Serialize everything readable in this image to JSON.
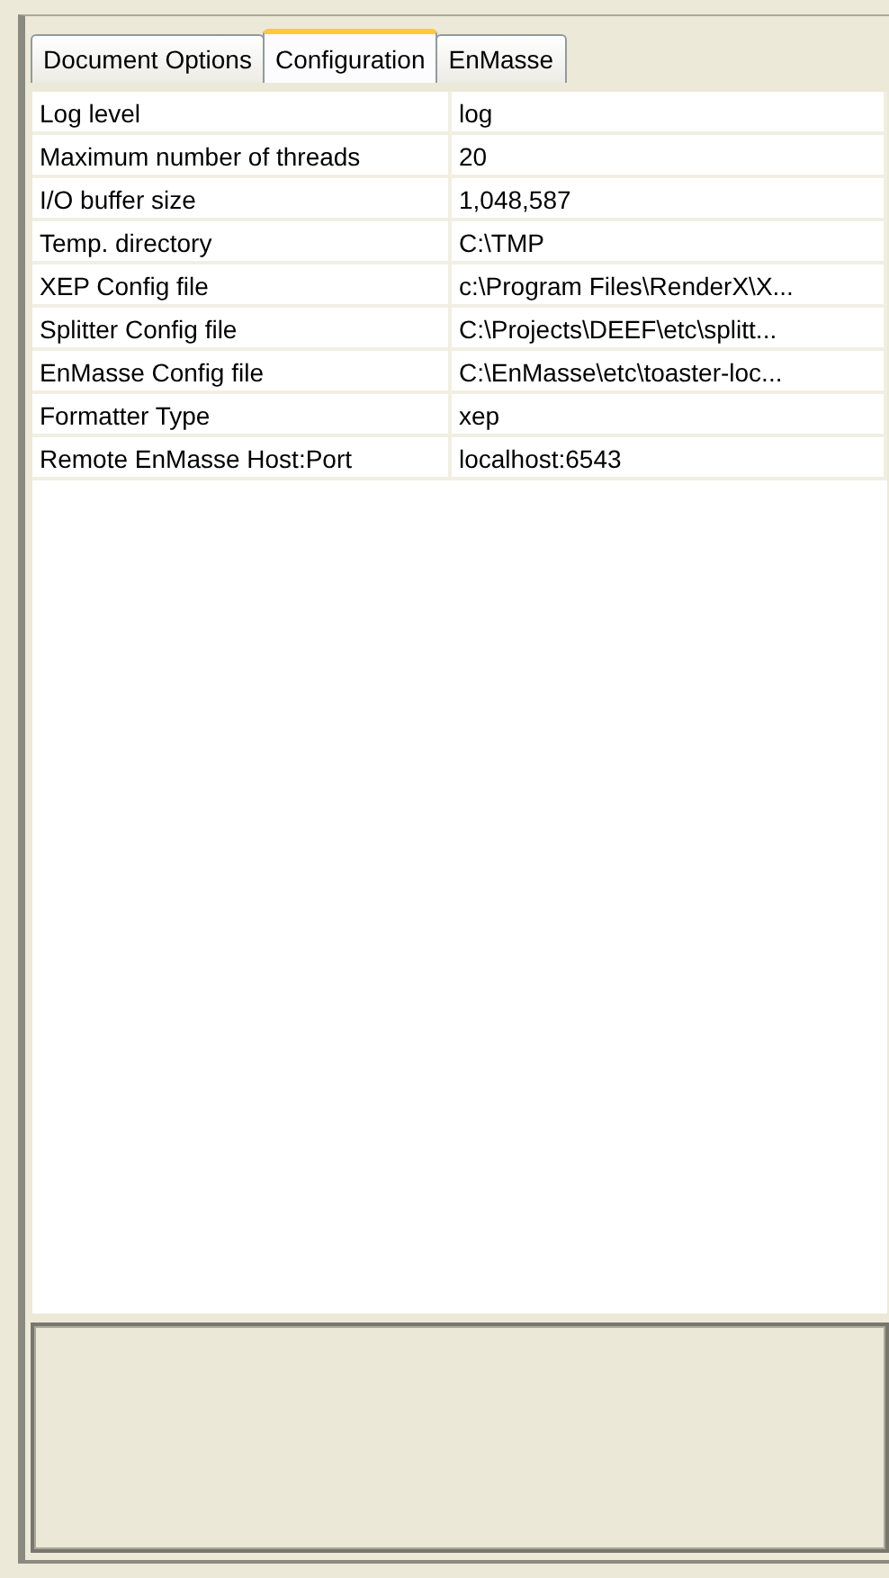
{
  "tabs": [
    {
      "label": "Document Options",
      "selected": false
    },
    {
      "label": "Configuration",
      "selected": true
    },
    {
      "label": "EnMasse",
      "selected": false
    }
  ],
  "properties": [
    {
      "name": "Log level",
      "value": "log"
    },
    {
      "name": "Maximum number of threads",
      "value": "20"
    },
    {
      "name": "I/O buffer size",
      "value": "1,048,587"
    },
    {
      "name": "Temp. directory",
      "value": "C:\\TMP"
    },
    {
      "name": "XEP Config file",
      "value": "c:\\Program Files\\RenderX\\X..."
    },
    {
      "name": "Splitter Config file",
      "value": "C:\\Projects\\DEEF\\etc\\splitt..."
    },
    {
      "name": "EnMasse Config file",
      "value": "C:\\EnMasse\\etc\\toaster-loc..."
    },
    {
      "name": "Formatter Type",
      "value": "xep"
    },
    {
      "name": "Remote EnMasse Host:Port",
      "value": "localhost:6543"
    }
  ]
}
